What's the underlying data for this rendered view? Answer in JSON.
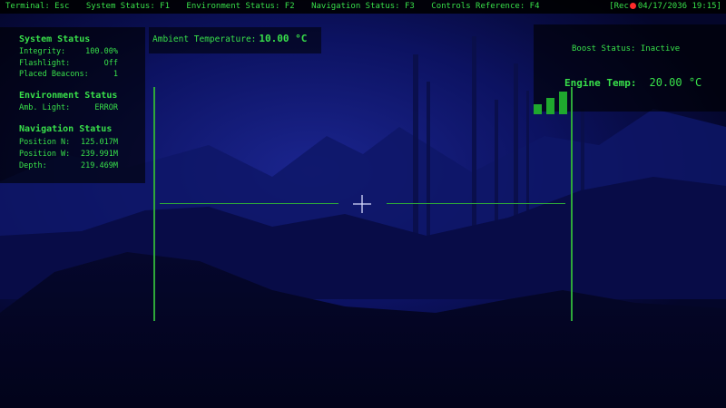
{
  "menu": [
    {
      "label": "Terminal: Esc"
    },
    {
      "label": "System Status: F1"
    },
    {
      "label": "Environment Status: F2"
    },
    {
      "label": "Navigation Status: F3"
    },
    {
      "label": "Controls Reference: F4"
    }
  ],
  "recording": {
    "prefix": "[Rec",
    "datetime": "04/17/2036 19:15]"
  },
  "system_status": {
    "title": "System Status",
    "integrity_label": "Integrity:",
    "integrity_value": "100.00%",
    "flashlight_label": "Flashlight:",
    "flashlight_value": "Off",
    "beacons_label": "Placed Beacons:",
    "beacons_value": "1"
  },
  "environment_status": {
    "title": "Environment Status",
    "light_label": "Amb. Light:",
    "light_value": "ERROR"
  },
  "navigation_status": {
    "title": "Navigation Status",
    "pos_n_label": "Position N:",
    "pos_n_value": "125.017M",
    "pos_w_label": "Position W:",
    "pos_w_value": "239.991M",
    "depth_label": "Depth:",
    "depth_value": "219.469M"
  },
  "ambient": {
    "label": "Ambient Temperature:",
    "value": "10.00 °C"
  },
  "boost": {
    "text": "Boost Status: Inactive"
  },
  "engine": {
    "label": "Engine Temp:",
    "value": "20.00 °C"
  },
  "signal": {
    "bars_active": 3
  },
  "colors": {
    "hud_green": "#38e04a",
    "rec_red": "#ff2b2b",
    "water": "#05072a"
  }
}
